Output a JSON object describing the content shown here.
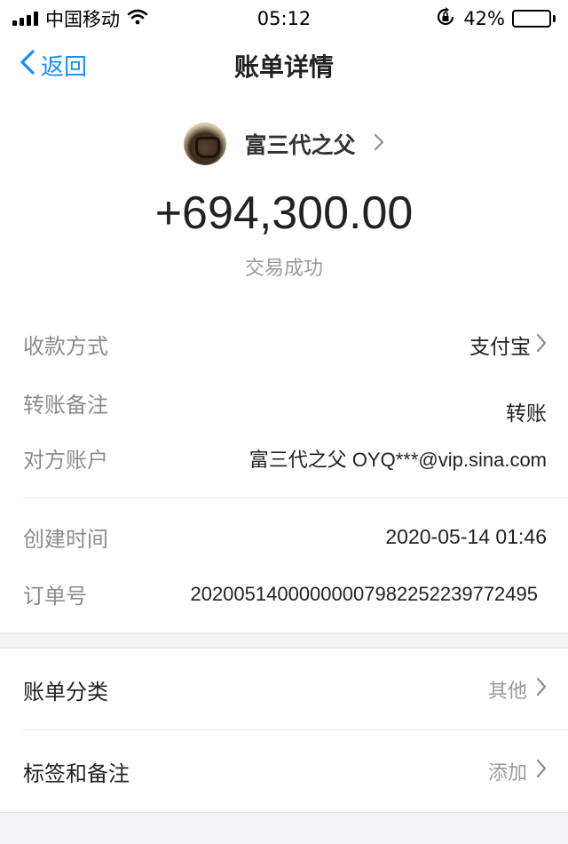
{
  "status_bar": {
    "carrier": "中国移动",
    "time": "05:12",
    "battery_text": "42%",
    "battery_level": 0.42,
    "icons": [
      "signal-icon",
      "wifi-icon",
      "orientation-lock-icon",
      "battery-icon"
    ]
  },
  "nav": {
    "back_label": "返回",
    "title": "账单详情"
  },
  "header": {
    "payer_name": "富三代之父",
    "amount": "+694,300.00",
    "status": "交易成功"
  },
  "details": {
    "payment_method": {
      "label": "收款方式",
      "value": "支付宝"
    },
    "transfer_note": {
      "label": "转账备注",
      "value": "转账"
    },
    "counterparty": {
      "label": "对方账户",
      "value": "富三代之父 OYQ***@vip.sina.com"
    },
    "created_time": {
      "label": "创建时间",
      "value": "2020-05-14 01:46"
    },
    "order_no": {
      "label": "订单号",
      "value": "20200514000000007982252239772495"
    }
  },
  "actions": {
    "category": {
      "label": "账单分类",
      "value": "其他"
    },
    "tags": {
      "label": "标签和备注",
      "value": "添加"
    }
  },
  "colors": {
    "accent": "#1a8cff",
    "muted": "#9a9a9a",
    "section_bg": "#f3f3f5"
  }
}
